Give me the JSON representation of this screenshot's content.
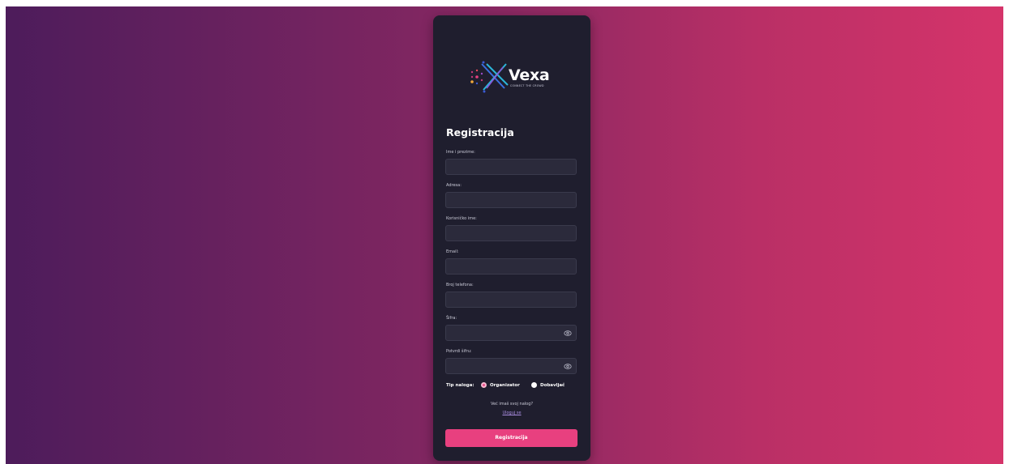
{
  "brand": {
    "name": "Vexa",
    "tagline": "CONNECT THE CROWD"
  },
  "form": {
    "title": "Registracija",
    "fields": [
      {
        "label": "Ime i prezime:",
        "value": ""
      },
      {
        "label": "Adresa:",
        "value": ""
      },
      {
        "label": "Korisničko ime:",
        "value": ""
      },
      {
        "label": "Email:",
        "value": ""
      },
      {
        "label": "Broj telefona:",
        "value": ""
      },
      {
        "label": "Šifra:",
        "value": ""
      },
      {
        "label": "Potvrdi šifru:",
        "value": ""
      }
    ],
    "account_type": {
      "label": "Tip naloga:",
      "options": [
        {
          "label": "Organizator",
          "selected": true
        },
        {
          "label": "Dobavljač",
          "selected": false
        }
      ]
    },
    "login_prompt": "Već imaš svoj nalog?",
    "login_link": "Uloguj se",
    "submit_label": "Registracija"
  },
  "icons": {
    "password_toggle": "eye-icon",
    "logo_mark": "vexa-x-logo-icon"
  },
  "colors": {
    "gradient_start": "#4d1c5b",
    "gradient_end": "#d5346a",
    "card_bg": "#1f1e2e",
    "input_bg": "#2b2a3b",
    "accent": "#e8407f",
    "link": "#a98ce0"
  }
}
